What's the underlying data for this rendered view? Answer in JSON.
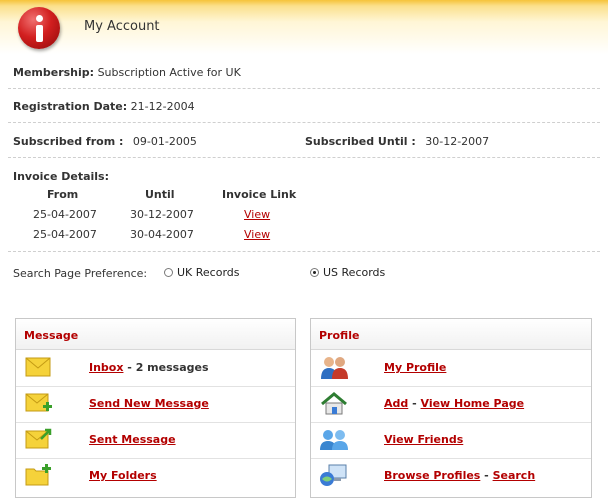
{
  "header": {
    "title": "My Account"
  },
  "membership": {
    "label": "Membership:",
    "value": "Subscription Active for UK"
  },
  "registration": {
    "label": "Registration Date:",
    "value": "21-12-2004"
  },
  "subscribed_from": {
    "label": "Subscribed from :",
    "value": "09-01-2005"
  },
  "subscribed_until": {
    "label": "Subscribed Until :",
    "value": "30-12-2007"
  },
  "invoice": {
    "label": "Invoice Details:",
    "columns": [
      "From",
      "Until",
      "Invoice Link"
    ],
    "rows": [
      {
        "from": "25-04-2007",
        "until": "30-12-2007",
        "link": "View"
      },
      {
        "from": "25-04-2007",
        "until": "30-04-2007",
        "link": "View"
      }
    ]
  },
  "search_pref": {
    "label": "Search Page Preference:",
    "options": [
      {
        "label": "UK Records",
        "checked": false
      },
      {
        "label": "US Records",
        "checked": true
      }
    ]
  },
  "message_panel": {
    "title": "Message",
    "inbox": {
      "link": "Inbox",
      "separator": " - ",
      "text": "2 messages"
    },
    "send_new": "Send New Message",
    "sent": "Sent Message",
    "folders": "My Folders"
  },
  "profile_panel": {
    "title": "Profile",
    "my_profile": "My Profile",
    "add": "Add",
    "dash1": " - ",
    "home": "View Home Page",
    "friends": "View Friends",
    "browse": "Browse Profiles",
    "dash2": " - ",
    "search": "Search"
  },
  "colors": {
    "accent": "#b30000",
    "header_gold": "#f6c33a",
    "envelope": "#f5d23a",
    "plus_green": "#3aa02a"
  }
}
